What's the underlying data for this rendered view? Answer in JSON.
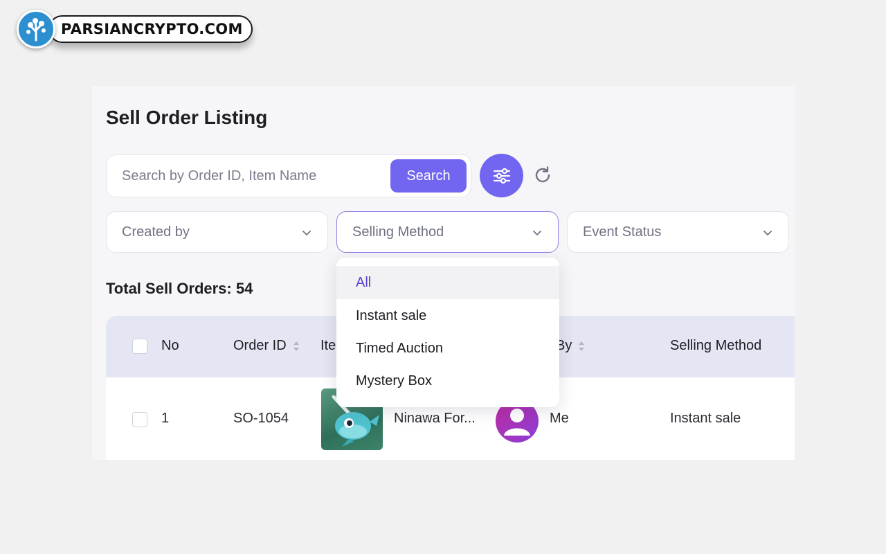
{
  "watermark": {
    "text": "PARSIANCRYPTO.COM"
  },
  "page": {
    "title": "Sell Order Listing"
  },
  "search": {
    "placeholder": "Search by Order ID, Item Name",
    "value": "",
    "button_label": "Search"
  },
  "toolbar": {
    "filter_icon": "sliders-icon",
    "refresh_icon": "refresh-icon"
  },
  "filters": {
    "created_by": {
      "label": "Created by"
    },
    "selling_method": {
      "label": "Selling Method"
    },
    "event_status": {
      "label": "Event Status"
    }
  },
  "dropdown": {
    "options": [
      "All",
      "Instant sale",
      "Timed Auction",
      "Mystery Box"
    ],
    "selected": "All"
  },
  "summary": {
    "total_label": "Total Sell Orders: 54"
  },
  "table": {
    "columns": {
      "no": "No",
      "order_id": "Order ID",
      "item": "Ite",
      "created_by": "By",
      "selling_method": "Selling Method"
    },
    "rows": [
      {
        "no": "1",
        "order_id": "SO-1054",
        "item_name": "Ninawa For...",
        "created_by": "Me",
        "selling_method": "Instant sale"
      }
    ]
  },
  "colors": {
    "accent": "#7266f0",
    "selected_text": "#5b3fd0",
    "header_bg": "#e4e6f3",
    "logo_blue": "#2b8fd0"
  }
}
